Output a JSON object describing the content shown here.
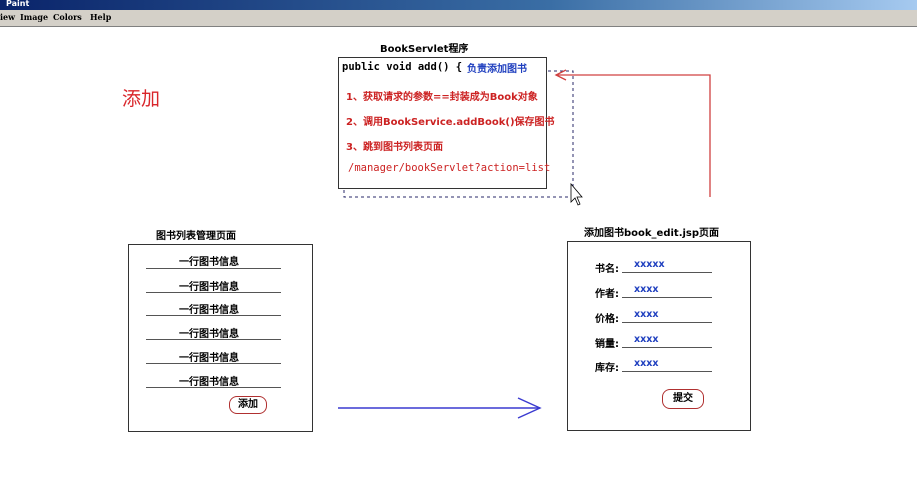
{
  "window": {
    "title": "Paint"
  },
  "menu": [
    "iew",
    "Image",
    "Colors",
    "Help"
  ],
  "diagram": {
    "heading": "添加",
    "servlet": {
      "title": "BookServlet程序",
      "method": "public void add()  {",
      "method_comment": "负责添加图书",
      "steps": [
        "1、获取请求的参数==封装成为Book对象",
        "2、调用BookService.addBook()保存图书",
        "3、跳到图书列表页面"
      ],
      "redirect": "/manager/bookServlet?action=list"
    },
    "list_page": {
      "title": "图书列表管理页面",
      "rows": [
        "一行图书信息",
        "一行图书信息",
        "一行图书信息",
        "一行图书信息",
        "一行图书信息",
        "一行图书信息"
      ],
      "add_button": "添加"
    },
    "edit_page": {
      "title": "添加图书book_edit.jsp页面",
      "fields": [
        {
          "label": "书名:",
          "value": "xxxxx"
        },
        {
          "label": "作者:",
          "value": "xxxx"
        },
        {
          "label": "价格:",
          "value": "xxxx"
        },
        {
          "label": "销量:",
          "value": "xxxx"
        },
        {
          "label": "库存:",
          "value": "xxxx"
        }
      ],
      "submit_button": "提交"
    }
  },
  "colors": {
    "accent_red": "#d9262b",
    "link_blue": "#1f3fbf",
    "arrow_blue": "#3a3ad0"
  }
}
